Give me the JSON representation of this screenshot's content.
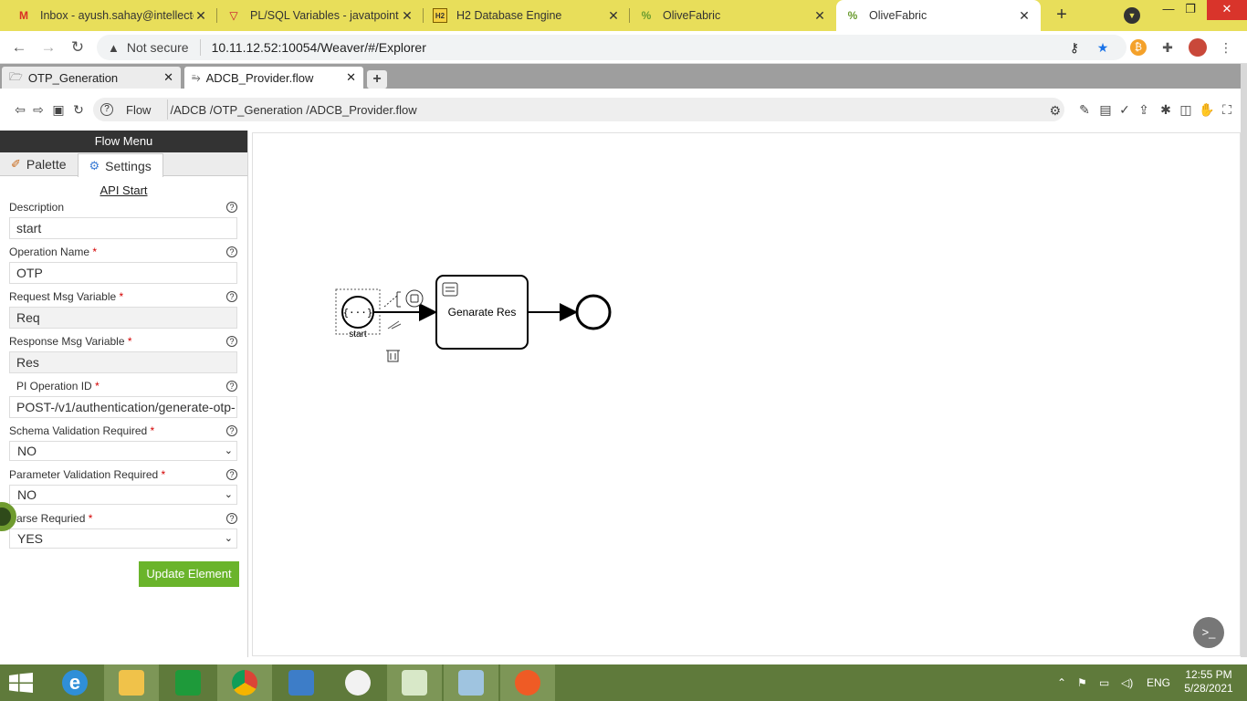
{
  "browser": {
    "tabs": [
      {
        "title": "Inbox - ayush.sahay@intellectd",
        "icon": "gmail-icon"
      },
      {
        "title": "PL/SQL Variables - javatpoint",
        "icon": "javatpoint-icon"
      },
      {
        "title": "H2 Database Engine",
        "icon": "h2-icon"
      },
      {
        "title": "OliveFabric",
        "icon": "olivefabric-icon"
      },
      {
        "title": "OliveFabric",
        "icon": "olivefabric-icon"
      }
    ],
    "security_label": "Not secure",
    "url": "10.11.12.52:10054/Weaver/#/Explorer"
  },
  "app_tabs": [
    {
      "title": "OTP_Generation"
    },
    {
      "title": "ADCB_Provider.flow"
    }
  ],
  "toolbar": {
    "flow_label": "Flow",
    "path": "/ADCB /OTP_Generation /ADCB_Provider.flow"
  },
  "panel": {
    "header": "Flow Menu",
    "tabs": [
      "Palette",
      "Settings"
    ],
    "section_title": "API Start",
    "fields": {
      "description": {
        "label": "Description",
        "value": "start"
      },
      "operation_name": {
        "label": "Operation Name",
        "value": "OTP"
      },
      "request_msg": {
        "label": "Request Msg Variable",
        "value": "Req"
      },
      "response_msg": {
        "label": "Response Msg Variable",
        "value": "Res"
      },
      "api_operation_id": {
        "label": "PI Operation ID",
        "value": "POST-/v1/authentication/generate-otp-"
      },
      "schema_validation": {
        "label": "Schema Validation Required",
        "value": "NO"
      },
      "parameter_validation": {
        "label": "Parameter Validation Required",
        "value": "NO"
      },
      "parse_required": {
        "label": "Parse Requried",
        "value": "YES"
      }
    },
    "required_mark": "*",
    "update_button": "Update Element"
  },
  "diagram": {
    "start_label": "start",
    "start_symbol": "{···}",
    "task_label": "Genarate Res"
  },
  "taskbar": {
    "lang": "ENG",
    "time": "12:55 PM",
    "date": "5/28/2021"
  },
  "colors": {
    "tabstrip": "#e8de5a",
    "update_button": "#6ab42b",
    "taskbar": "#5f7a3b"
  }
}
